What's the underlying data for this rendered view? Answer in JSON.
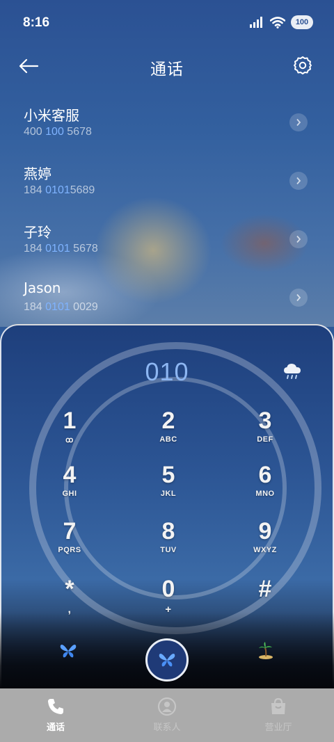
{
  "status_bar": {
    "time": "8:16",
    "battery": "100",
    "icons": [
      "signal-icon",
      "wifi-icon",
      "battery-icon"
    ]
  },
  "header": {
    "title": "通话",
    "back_icon": "back-arrow-icon",
    "settings_icon": "gear-icon"
  },
  "recent_calls": [
    {
      "name": "小米客服",
      "number_parts": [
        "400 ",
        "100",
        " 5678"
      ]
    },
    {
      "name": "燕婷",
      "number_parts": [
        "184 ",
        "0101",
        "5689"
      ]
    },
    {
      "name": "子玲",
      "number_parts": [
        "184 ",
        "0101",
        " 5678"
      ]
    },
    {
      "name": "Jason",
      "number_parts": [
        "184 ",
        "0101",
        " 0029"
      ]
    }
  ],
  "dialer": {
    "dialed_number": "010",
    "weather_icon": "cloud-rain-icon",
    "keys": [
      {
        "digit": "1",
        "letters": "ꝏ"
      },
      {
        "digit": "2",
        "letters": "ABC"
      },
      {
        "digit": "3",
        "letters": "DEF"
      },
      {
        "digit": "4",
        "letters": "GHI"
      },
      {
        "digit": "5",
        "letters": "JKL"
      },
      {
        "digit": "6",
        "letters": "MNO"
      },
      {
        "digit": "7",
        "letters": "PQRS"
      },
      {
        "digit": "8",
        "letters": "TUV"
      },
      {
        "digit": "9",
        "letters": "WXYZ"
      },
      {
        "digit": "*",
        "letters": ","
      },
      {
        "digit": "0",
        "letters": "+"
      },
      {
        "digit": "#",
        "letters": ""
      }
    ],
    "left_button_icon": "butterfly-icon",
    "call_button_icon": "butterfly-icon",
    "right_button_icon": "palm-island-icon"
  },
  "bottom_nav": [
    {
      "label": "通话",
      "icon": "phone-icon",
      "active": true
    },
    {
      "label": "联系人",
      "icon": "contact-person-icon",
      "active": false
    },
    {
      "label": "营业厅",
      "icon": "shopping-bag-icon",
      "active": false
    }
  ],
  "colors": {
    "accent_blue": "#7fb3ff",
    "dialed_number": "#8db6f2",
    "nav_background": "#ababab"
  }
}
